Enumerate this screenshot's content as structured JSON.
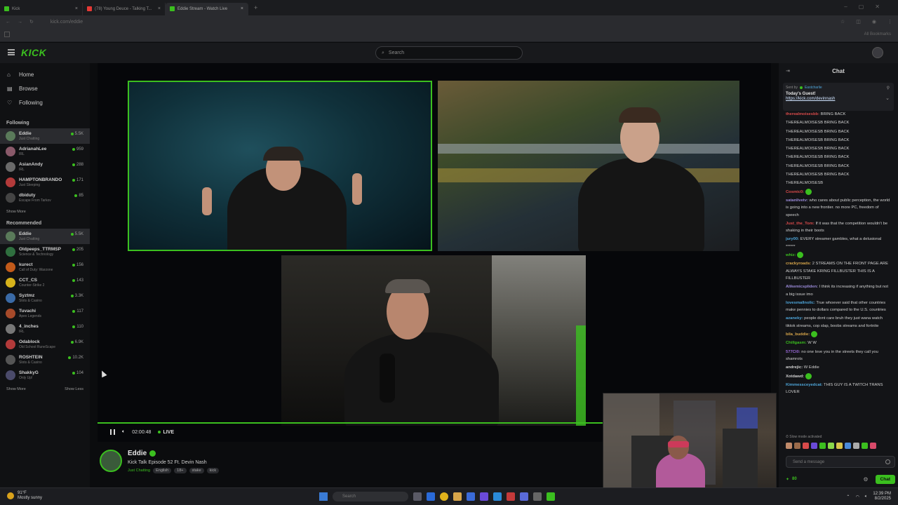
{
  "browser": {
    "tabs": [
      {
        "label": "Kick",
        "color": "#3bbf1f"
      },
      {
        "label": "(78) Young Deuce - Talking T...",
        "color": "#e53935"
      },
      {
        "label": "Eddie Stream - Watch Live",
        "color": "#3bbf1f"
      }
    ],
    "url": "kick.com/eddie",
    "all_bookmarks": "All Bookmarks"
  },
  "header": {
    "logo": "KICK",
    "search_placeholder": "Search"
  },
  "sidebar": {
    "nav": [
      {
        "label": "Home",
        "icon": "home-icon",
        "glyph": "⌂"
      },
      {
        "label": "Browse",
        "icon": "browse-icon",
        "glyph": "▤"
      },
      {
        "label": "Following",
        "icon": "heart-icon",
        "glyph": "♡"
      }
    ],
    "following_title": "Following",
    "following": [
      {
        "name": "Eddie",
        "category": "Just Chatting",
        "viewers": "5.5K",
        "color": "#5a7a5a",
        "hl": true
      },
      {
        "name": "AdrianahLee",
        "category": "IRL",
        "viewers": "959",
        "color": "#8a5a6a"
      },
      {
        "name": "AsianAndy",
        "category": "IRL",
        "viewers": "288",
        "color": "#6a6a6a"
      },
      {
        "name": "HAMPTONBRANDO",
        "category": "Just Sleeping",
        "viewers": "171",
        "color": "#b33a3a"
      },
      {
        "name": "dbiduty",
        "category": "Escape From Tarkov",
        "viewers": "85",
        "color": "#444"
      }
    ],
    "show_more_1": "Show More",
    "recommended_title": "Recommended",
    "recommended": [
      {
        "name": "Eddie",
        "category": "Just Chatting",
        "viewers": "5.5K",
        "color": "#5a7a5a",
        "hl": true
      },
      {
        "name": "Oldpeeps_TTRMSP",
        "category": "Science & Technology",
        "viewers": "205",
        "color": "#2f6f3f"
      },
      {
        "name": "kurect",
        "category": "Call of Duty: Warzone",
        "viewers": "156",
        "color": "#c25a1a"
      },
      {
        "name": "CCT_CS",
        "category": "Counter-Strike 2",
        "viewers": "143",
        "color": "#d6b21b"
      },
      {
        "name": "Syztmz",
        "category": "Slots & Casino",
        "viewers": "3.3K",
        "color": "#3a6aa6"
      },
      {
        "name": "Tuvachi",
        "category": "Apex Legends",
        "viewers": "117",
        "color": "#a64a2a"
      },
      {
        "name": "4_inches",
        "category": "IRL",
        "viewers": "110",
        "color": "#777"
      },
      {
        "name": "Odablock",
        "category": "Old School RuneScape",
        "viewers": "6.9K",
        "color": "#b23a3a"
      },
      {
        "name": "ROSHTEIN",
        "category": "Slots & Casino",
        "viewers": "10.2K",
        "color": "#555"
      },
      {
        "name": "ShakkyG",
        "category": "Only Up!",
        "viewers": "104",
        "color": "#4a4a6a"
      }
    ],
    "show_more_2": "Show More",
    "show_less": "Show Less"
  },
  "player": {
    "time": "02:00:48",
    "live": "LIVE",
    "progress": 0.75
  },
  "stream": {
    "name": "Eddie",
    "title": "Kick Talk Episode 52 Ft. Devin Nash",
    "category": "Just Chatting",
    "tags": [
      "English",
      "18+",
      "stake",
      "kick"
    ]
  },
  "chat": {
    "title": "Chat",
    "pinned_by_label": "Sent by",
    "pinned_by": "Eastcharlie",
    "pinned_title": "Today's Guest!",
    "pinned_link": "https://kick.com/devinnash",
    "messages": [
      {
        "user": "therealmoisesbb:",
        "color": "#d84a4a",
        "text": "BRING BACK"
      },
      {
        "user": "",
        "color": "",
        "text": "THEREALMOISESB BRING BACK"
      },
      {
        "user": "",
        "color": "",
        "text": "THEREALMOISESB BRING BACK"
      },
      {
        "user": "",
        "color": "",
        "text": "THEREALMOISESB BRING BACK"
      },
      {
        "user": "",
        "color": "",
        "text": "THEREALMOISESB BRING BACK"
      },
      {
        "user": "",
        "color": "",
        "text": "THEREALMOISESB BRING BACK"
      },
      {
        "user": "",
        "color": "",
        "text": "THEREALMOISESB BRING BACK"
      },
      {
        "user": "",
        "color": "",
        "text": "THEREALMOISESB BRING BACK"
      },
      {
        "user": "",
        "color": "",
        "text": "THEREALMOISESB"
      },
      {
        "user": "Cosmic0:",
        "color": "#d84a4a",
        "text": ""
      },
      {
        "user": "satanlivetv:",
        "color": "#9a8ad8",
        "text": "who cares about public perception, the world is going into a new frontier. no more PC, freedom of speech"
      },
      {
        "user": "Just_the_Tom:",
        "color": "#d84a4a",
        "text": "If it was that the competition wouldn't be shaking in their boots"
      },
      {
        "user": "jury00:",
        "color": "#4ea5d9",
        "text": "EVERY streamer gambles, what a delusional ******"
      },
      {
        "user": "whiz:",
        "color": "#3bbf1f",
        "text": ""
      },
      {
        "user": "crackyroads:",
        "color": "#d8a64a",
        "text": "2 STREAMS ON THE FRONT PAGE ARE ALWAYS STAKE KRING FILLBUSTER THIS IS A FILLBUSTER"
      },
      {
        "user": "Alikemicspliden:",
        "color": "#9a8ad8",
        "text": "I think its increasing if anything but not a big issue imo"
      },
      {
        "user": "lovesmallnolic:",
        "color": "#4ea5d9",
        "text": "True whoever said that other countries make pennies to dollars compared to the U.S. countries"
      },
      {
        "user": "azaneky:",
        "color": "#4ea5d9",
        "text": "people dont care bruh they just wana watch tiktok streams, cop slap, boobs streams and fortnite"
      },
      {
        "user": "bila_buddie:",
        "color": "#d8a64a",
        "text": ""
      },
      {
        "user": "Chillgasm:",
        "color": "#3bbf1f",
        "text": "W W"
      },
      {
        "user": "577Cl0:",
        "color": "#9a6ad8",
        "text": "no one love you in the streets they call you shamrots"
      },
      {
        "user": "andrejic:",
        "color": "#d0d0d0",
        "text": "W Eddie"
      },
      {
        "user": "Xotdawd:",
        "color": "#d0d0d0",
        "text": ""
      },
      {
        "user": "Kimmessceyedcat:",
        "color": "#4ea5d9",
        "text": "THIS GUY IS A TWITCH TRANS LOVER"
      }
    ],
    "slow_mode": "Slow mode activated",
    "input_placeholder": "Send a message",
    "points": "80",
    "send_label": "Chat"
  },
  "taskbar": {
    "temp": "91°F",
    "weather": "Mostly sunny",
    "search_placeholder": "Search",
    "time": "12:39 PM",
    "date": "8/2/2025"
  }
}
